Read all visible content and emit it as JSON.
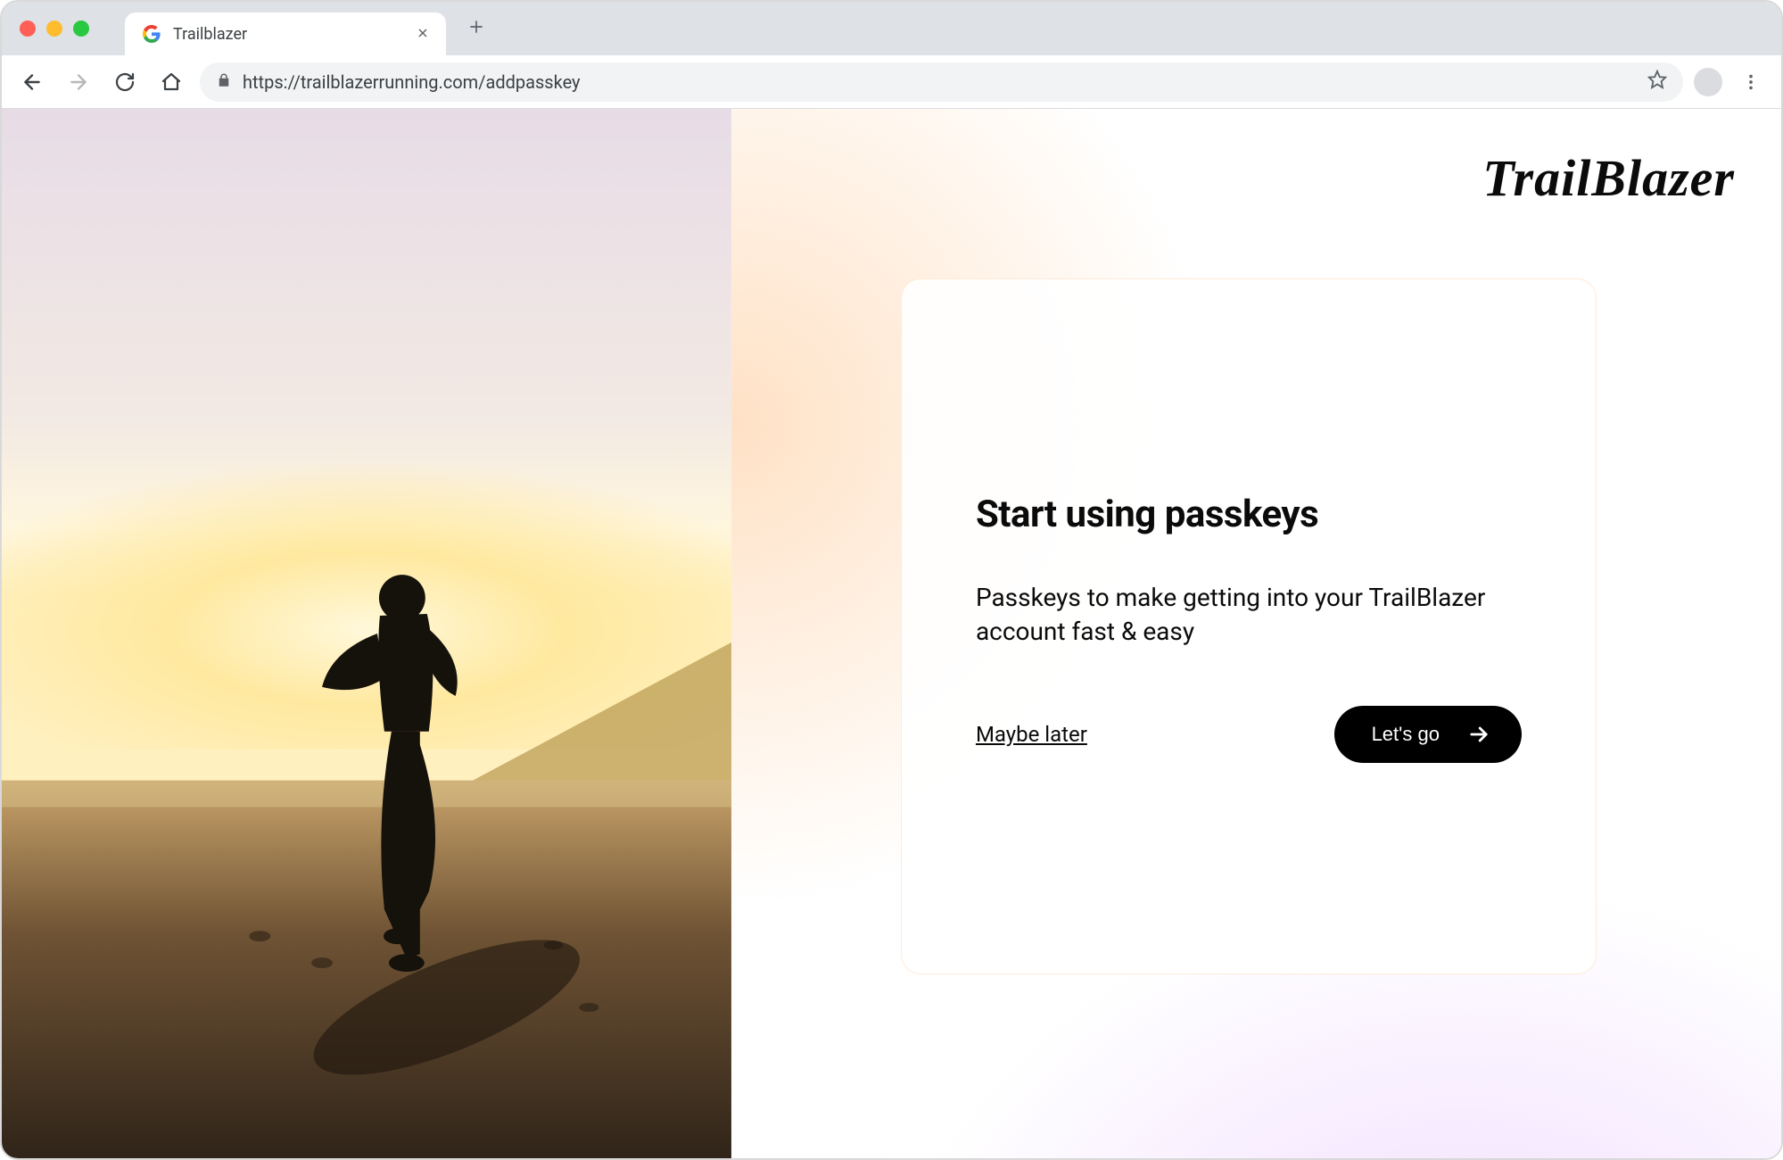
{
  "browser": {
    "tab_title": "Trailblazer",
    "url": "https://trailblazerrunning.com/addpasskey"
  },
  "brand": "TrailBlazer",
  "card": {
    "title": "Start using passkeys",
    "description": "Passkeys to make getting into your TrailBlazer account fast & easy",
    "maybe_later": "Maybe later",
    "cta": "Let's go"
  }
}
